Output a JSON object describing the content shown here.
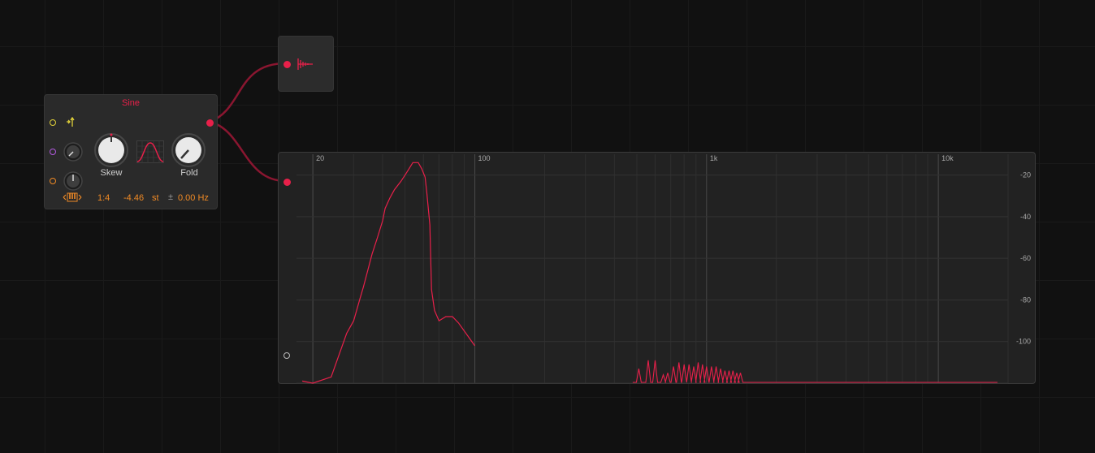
{
  "oscillator": {
    "title": "Sine",
    "knobs": [
      {
        "label": "Skew",
        "value": 0.5
      },
      {
        "label": "Fold",
        "value": 0.12
      }
    ],
    "ratio": "1:4",
    "pitch_value": "-4.46",
    "pitch_unit": "st",
    "plusminus": "±",
    "offset": "0.00 Hz",
    "icons": [
      "trigger-arrow-icon",
      "sine-wave-display-icon",
      "keyboard-icon"
    ]
  },
  "output_module": {
    "icon": "waveform-decay-icon"
  },
  "analyzer": {
    "freq_labels": [
      "20",
      "100",
      "1k",
      "10k"
    ],
    "db_labels": [
      "-20",
      "-40",
      "-60",
      "-80",
      "-100"
    ],
    "colors": {
      "trace": "#e8204a",
      "accent": "#f08a25"
    }
  },
  "chart_data": {
    "type": "line",
    "xlabel": "",
    "ylabel": "",
    "x_scale": "log",
    "xlim": [
      17,
      20000
    ],
    "ylim": [
      -120,
      -10
    ],
    "x_ticks": [
      "20",
      "100",
      "1k",
      "10k"
    ],
    "y_ticks": [
      "-20",
      "-40",
      "-60",
      "-80",
      "-100"
    ],
    "grid": true,
    "series": [
      {
        "x": [
          18,
          20,
          24,
          28,
          30,
          32,
          33,
          36,
          38,
          40,
          41,
          43,
          45,
          48,
          50,
          52,
          54,
          57,
          59,
          61,
          62,
          64,
          65,
          67,
          70,
          75,
          80,
          85,
          100
        ],
        "y": [
          -119,
          -121,
          -117,
          -96,
          -90,
          -79,
          -74,
          -58,
          -50,
          -42,
          -36,
          -31,
          -27,
          -23,
          -20,
          -17,
          -14,
          -14,
          -17,
          -21,
          -28,
          -44,
          -75,
          -85,
          -90,
          -88,
          -88,
          -91,
          -102
        ]
      }
    ],
    "harmonics": {
      "x": [
        510,
        560,
        600,
        650,
        680,
        720,
        760,
        800,
        840,
        880,
        920,
        960,
        1000,
        1050,
        1100,
        1150,
        1200,
        1250,
        1300,
        1350,
        1400
      ],
      "y": [
        -113,
        -109,
        -109,
        -116,
        -115,
        -112,
        -110,
        -111,
        -111,
        -112,
        -110,
        -111,
        -112,
        -112,
        -112,
        -113,
        -114,
        -114,
        -114,
        -115,
        -115
      ]
    }
  }
}
